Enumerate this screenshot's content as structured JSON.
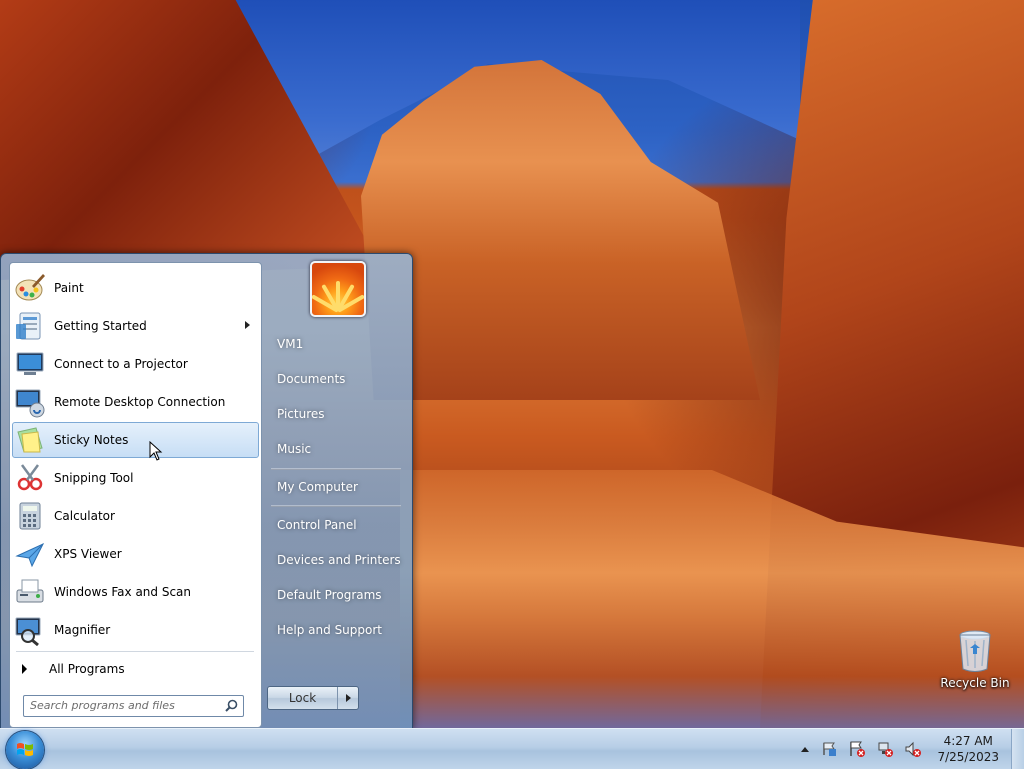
{
  "start_menu": {
    "programs": [
      {
        "label": "Paint",
        "icon": "paint-icon",
        "has_submenu": false,
        "highlighted": false
      },
      {
        "label": "Getting Started",
        "icon": "getting-started-icon",
        "has_submenu": true,
        "highlighted": false
      },
      {
        "label": "Connect to a Projector",
        "icon": "projector-icon",
        "has_submenu": false,
        "highlighted": false
      },
      {
        "label": "Remote Desktop Connection",
        "icon": "remote-desktop-icon",
        "has_submenu": false,
        "highlighted": false
      },
      {
        "label": "Sticky Notes",
        "icon": "sticky-notes-icon",
        "has_submenu": false,
        "highlighted": true
      },
      {
        "label": "Snipping Tool",
        "icon": "snipping-tool-icon",
        "has_submenu": false,
        "highlighted": false
      },
      {
        "label": "Calculator",
        "icon": "calculator-icon",
        "has_submenu": false,
        "highlighted": false
      },
      {
        "label": "XPS Viewer",
        "icon": "xps-viewer-icon",
        "has_submenu": false,
        "highlighted": false
      },
      {
        "label": "Windows Fax and Scan",
        "icon": "fax-scan-icon",
        "has_submenu": false,
        "highlighted": false
      },
      {
        "label": "Magnifier",
        "icon": "magnifier-icon",
        "has_submenu": false,
        "highlighted": false
      }
    ],
    "all_programs_label": "All Programs",
    "search_placeholder": "Search programs and files",
    "right_items": {
      "user": "VM1",
      "documents": "Documents",
      "pictures": "Pictures",
      "music": "Music",
      "computer": "My Computer",
      "control_panel": "Control Panel",
      "devices": "Devices and Printers",
      "default_programs": "Default Programs",
      "help": "Help and Support"
    },
    "lock_label": "Lock"
  },
  "desktop": {
    "recycle_bin_label": "Recycle Bin"
  },
  "taskbar": {
    "time": "4:27 AM",
    "date": "7/25/2023",
    "tray_icons": [
      "action-center-icon",
      "flag-error-icon",
      "network-error-icon",
      "volume-muted-icon"
    ]
  },
  "colors": {
    "highlight": "#c7def5",
    "taskbar": "#b7cee6",
    "menu_glass": "#8fb0d2"
  }
}
